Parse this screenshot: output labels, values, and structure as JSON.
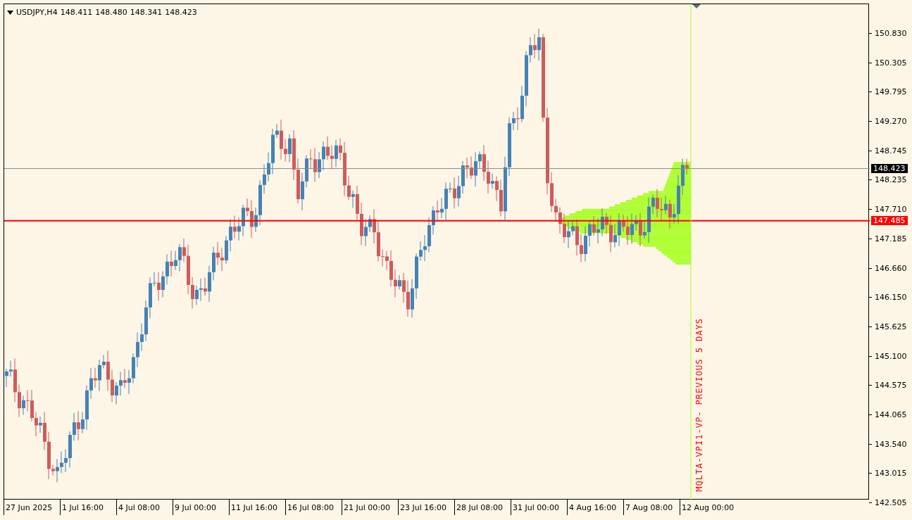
{
  "header": {
    "symbol": "USDJPY,H4",
    "quotes": [
      "148.411",
      "148.480",
      "148.341",
      "148.423"
    ]
  },
  "price_axis": {
    "labels": [
      "150.830",
      "150.305",
      "149.795",
      "149.270",
      "148.745",
      "148.235",
      "147.710",
      "147.185",
      "146.660",
      "146.150",
      "145.625",
      "145.100",
      "144.575",
      "144.065",
      "143.540",
      "143.015",
      "142.505"
    ]
  },
  "price_badges": [
    {
      "kind": "bid",
      "value": "148.423"
    },
    {
      "kind": "level",
      "value": "147.485"
    }
  ],
  "time_axis": {
    "labels": [
      "27 Jun 2025",
      "1 Jul 16:00",
      "4 Jul 08:00",
      "9 Jul 00:00",
      "11 Jul 16:00",
      "16 Jul 08:00",
      "21 Jul 00:00",
      "23 Jul 16:00",
      "28 Jul 08:00",
      "31 Jul 00:00",
      "4 Aug 16:00",
      "7 Aug 08:00",
      "12 Aug 00:00"
    ]
  },
  "indicator_label": "MQLTA-VPI1-VP- PREVIOUS 5 DAYS"
}
